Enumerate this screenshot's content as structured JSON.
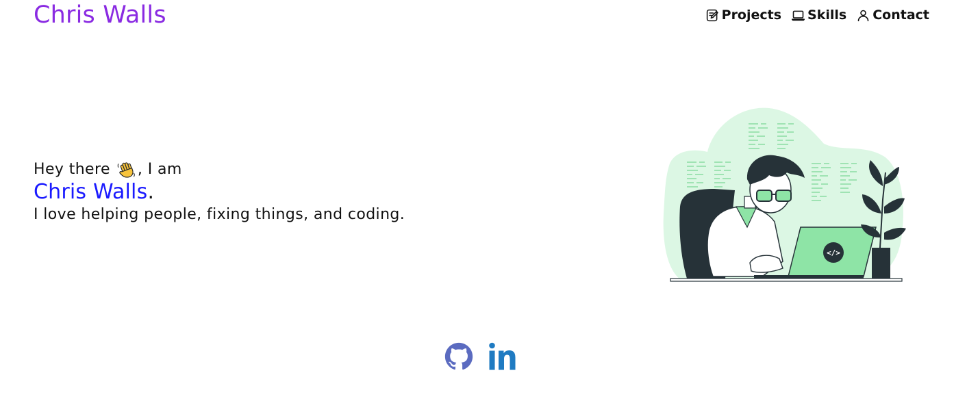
{
  "header": {
    "brand": "Chris Walls",
    "nav": [
      {
        "label": "Projects",
        "icon": "edit-note-icon"
      },
      {
        "label": "Skills",
        "icon": "laptop-icon"
      },
      {
        "label": "Contact",
        "icon": "person-icon"
      }
    ]
  },
  "hero": {
    "greeting_prefix": "Hey there",
    "wave_emoji": "waving-hand-icon",
    "greeting_suffix": ", I am",
    "name": "Chris Walls",
    "name_suffix": ".",
    "tagline": "I love helping people, fixing things, and coding.",
    "illustration": "developer-at-laptop-illustration",
    "laptop_badge": "</>"
  },
  "socials": [
    {
      "icon": "github-icon"
    },
    {
      "icon": "linkedin-icon"
    }
  ],
  "colors": {
    "brand": "#8a2be2",
    "name_highlight": "#1a1aff",
    "illustration_green": "#8ee4a6",
    "illustration_bg": "#dcf7e4",
    "github": "#5b6bc0",
    "linkedin": "#1f7bc2"
  }
}
